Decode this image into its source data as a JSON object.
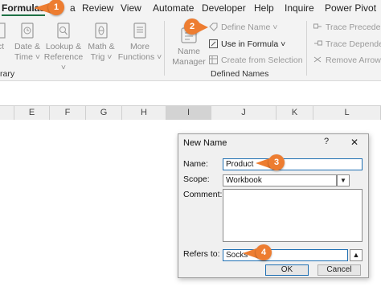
{
  "menu": {
    "tabs": [
      "Formulas",
      "Review",
      "View",
      "Automate",
      "Developer",
      "Help",
      "Inquire",
      "Power Pivot"
    ],
    "partial_tab": "a"
  },
  "ribbon": {
    "function_library": {
      "edge_fragment": "ct",
      "items": [
        {
          "label1": "Date &",
          "label2": "Time ˅",
          "icon": "clock-icon"
        },
        {
          "label1": "Lookup &",
          "label2": "Reference ˅",
          "icon": "magnifier-icon"
        },
        {
          "label1": "Math &",
          "label2": "Trig ˅",
          "icon": "theta-icon"
        },
        {
          "label1": "More",
          "label2": "Functions ˅",
          "icon": "more-functions-icon"
        }
      ],
      "group_label_fragment": "rary"
    },
    "defined_names": {
      "name_manager_label1": "Name",
      "name_manager_label2": "Manager",
      "define_name": "Define Name ˅",
      "use_in_formula": "Use in Formula ˅",
      "create_from_selection": "Create from Selection",
      "group_label": "Defined Names"
    },
    "formula_auditing": {
      "trace_precedents": "Trace Precedents",
      "trace_dependents": "Trace Dependents",
      "remove_arrows": "Remove Arrows ˅"
    }
  },
  "sheet": {
    "columns": [
      "E",
      "F",
      "G",
      "H",
      "I",
      "J",
      "K",
      "L"
    ],
    "selected_column": "I"
  },
  "dialog": {
    "title": "New Name",
    "help": "?",
    "close": "✕",
    "name_label": "Name:",
    "name_value": "Product",
    "scope_label": "Scope:",
    "scope_value": "Workbook",
    "comment_label": "Comment:",
    "comment_value": "",
    "refers_label": "Refers to:",
    "refers_value": "Socks",
    "ok_label": "OK",
    "cancel_label": "Cancel"
  },
  "callouts": [
    "1",
    "2",
    "3",
    "4"
  ],
  "colors": {
    "accent": "#ed7d31",
    "excel_green": "#1e7145",
    "focus_blue": "#1f6fb2"
  }
}
